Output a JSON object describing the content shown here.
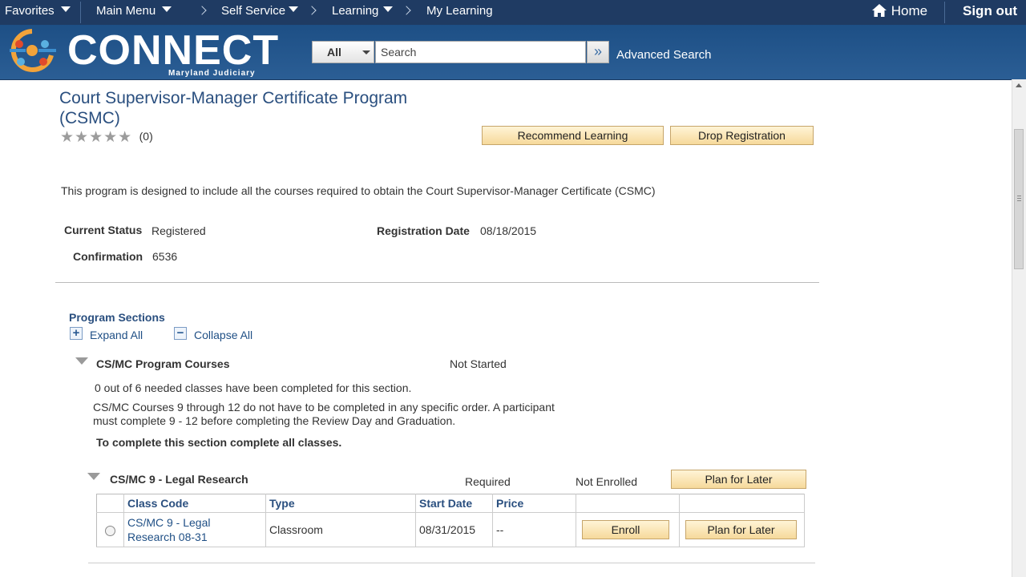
{
  "topnav": {
    "favorites": "Favorites",
    "main_menu": "Main Menu",
    "self_service": "Self Service",
    "learning": "Learning",
    "my_learning": "My Learning",
    "home": "Home",
    "sign_out": "Sign out"
  },
  "header": {
    "logo_text": "CONNECT",
    "logo_subtext": "Maryland Judiciary",
    "search_category": "All",
    "search_placeholder": "Search",
    "search_go_glyph": "»",
    "advanced_search": "Advanced Search"
  },
  "program": {
    "title": "Court Supervisor-Manager Certificate Program (CSMC)",
    "rating_count": "(0)",
    "rating_stars": 0,
    "recommend_button": "Recommend Learning",
    "drop_button": "Drop Registration",
    "description": "This program is designed to include all the courses required to obtain the Court Supervisor-Manager Certificate (CSMC)",
    "current_status_label": "Current Status",
    "current_status_value": "Registered",
    "registration_date_label": "Registration Date",
    "registration_date_value": "08/18/2015",
    "confirmation_label": "Confirmation",
    "confirmation_value": "6536"
  },
  "sections": {
    "heading": "Program Sections",
    "expand_all": "Expand All",
    "collapse_all": "Collapse All",
    "section1": {
      "title": "CS/MC Program Courses",
      "status": "Not Started",
      "progress_text": "0 out of 6 needed classes have been completed for this section.",
      "note_line1": "CS/MC Courses 9 through 12 do not have to be completed in any specific order. A participant",
      "note_line2": "must complete 9 - 12 before completing the Review Day and Graduation.",
      "instruction": "To complete this section complete all classes."
    },
    "course1": {
      "title": "CS/MC 9 - Legal Research",
      "requirement": "Required",
      "enrollment_status": "Not Enrolled",
      "plan_button": "Plan for Later",
      "table": {
        "headers": [
          "Class Code",
          "Type",
          "Start Date",
          "Price",
          "",
          ""
        ],
        "row": {
          "class_code_line1": "CS/MC 9 - Legal",
          "class_code_line2": "Research 08-31",
          "type": "Classroom",
          "start_date": "08/31/2015",
          "price": "--",
          "enroll_button": "Enroll",
          "plan_button": "Plan for Later"
        }
      }
    }
  }
}
